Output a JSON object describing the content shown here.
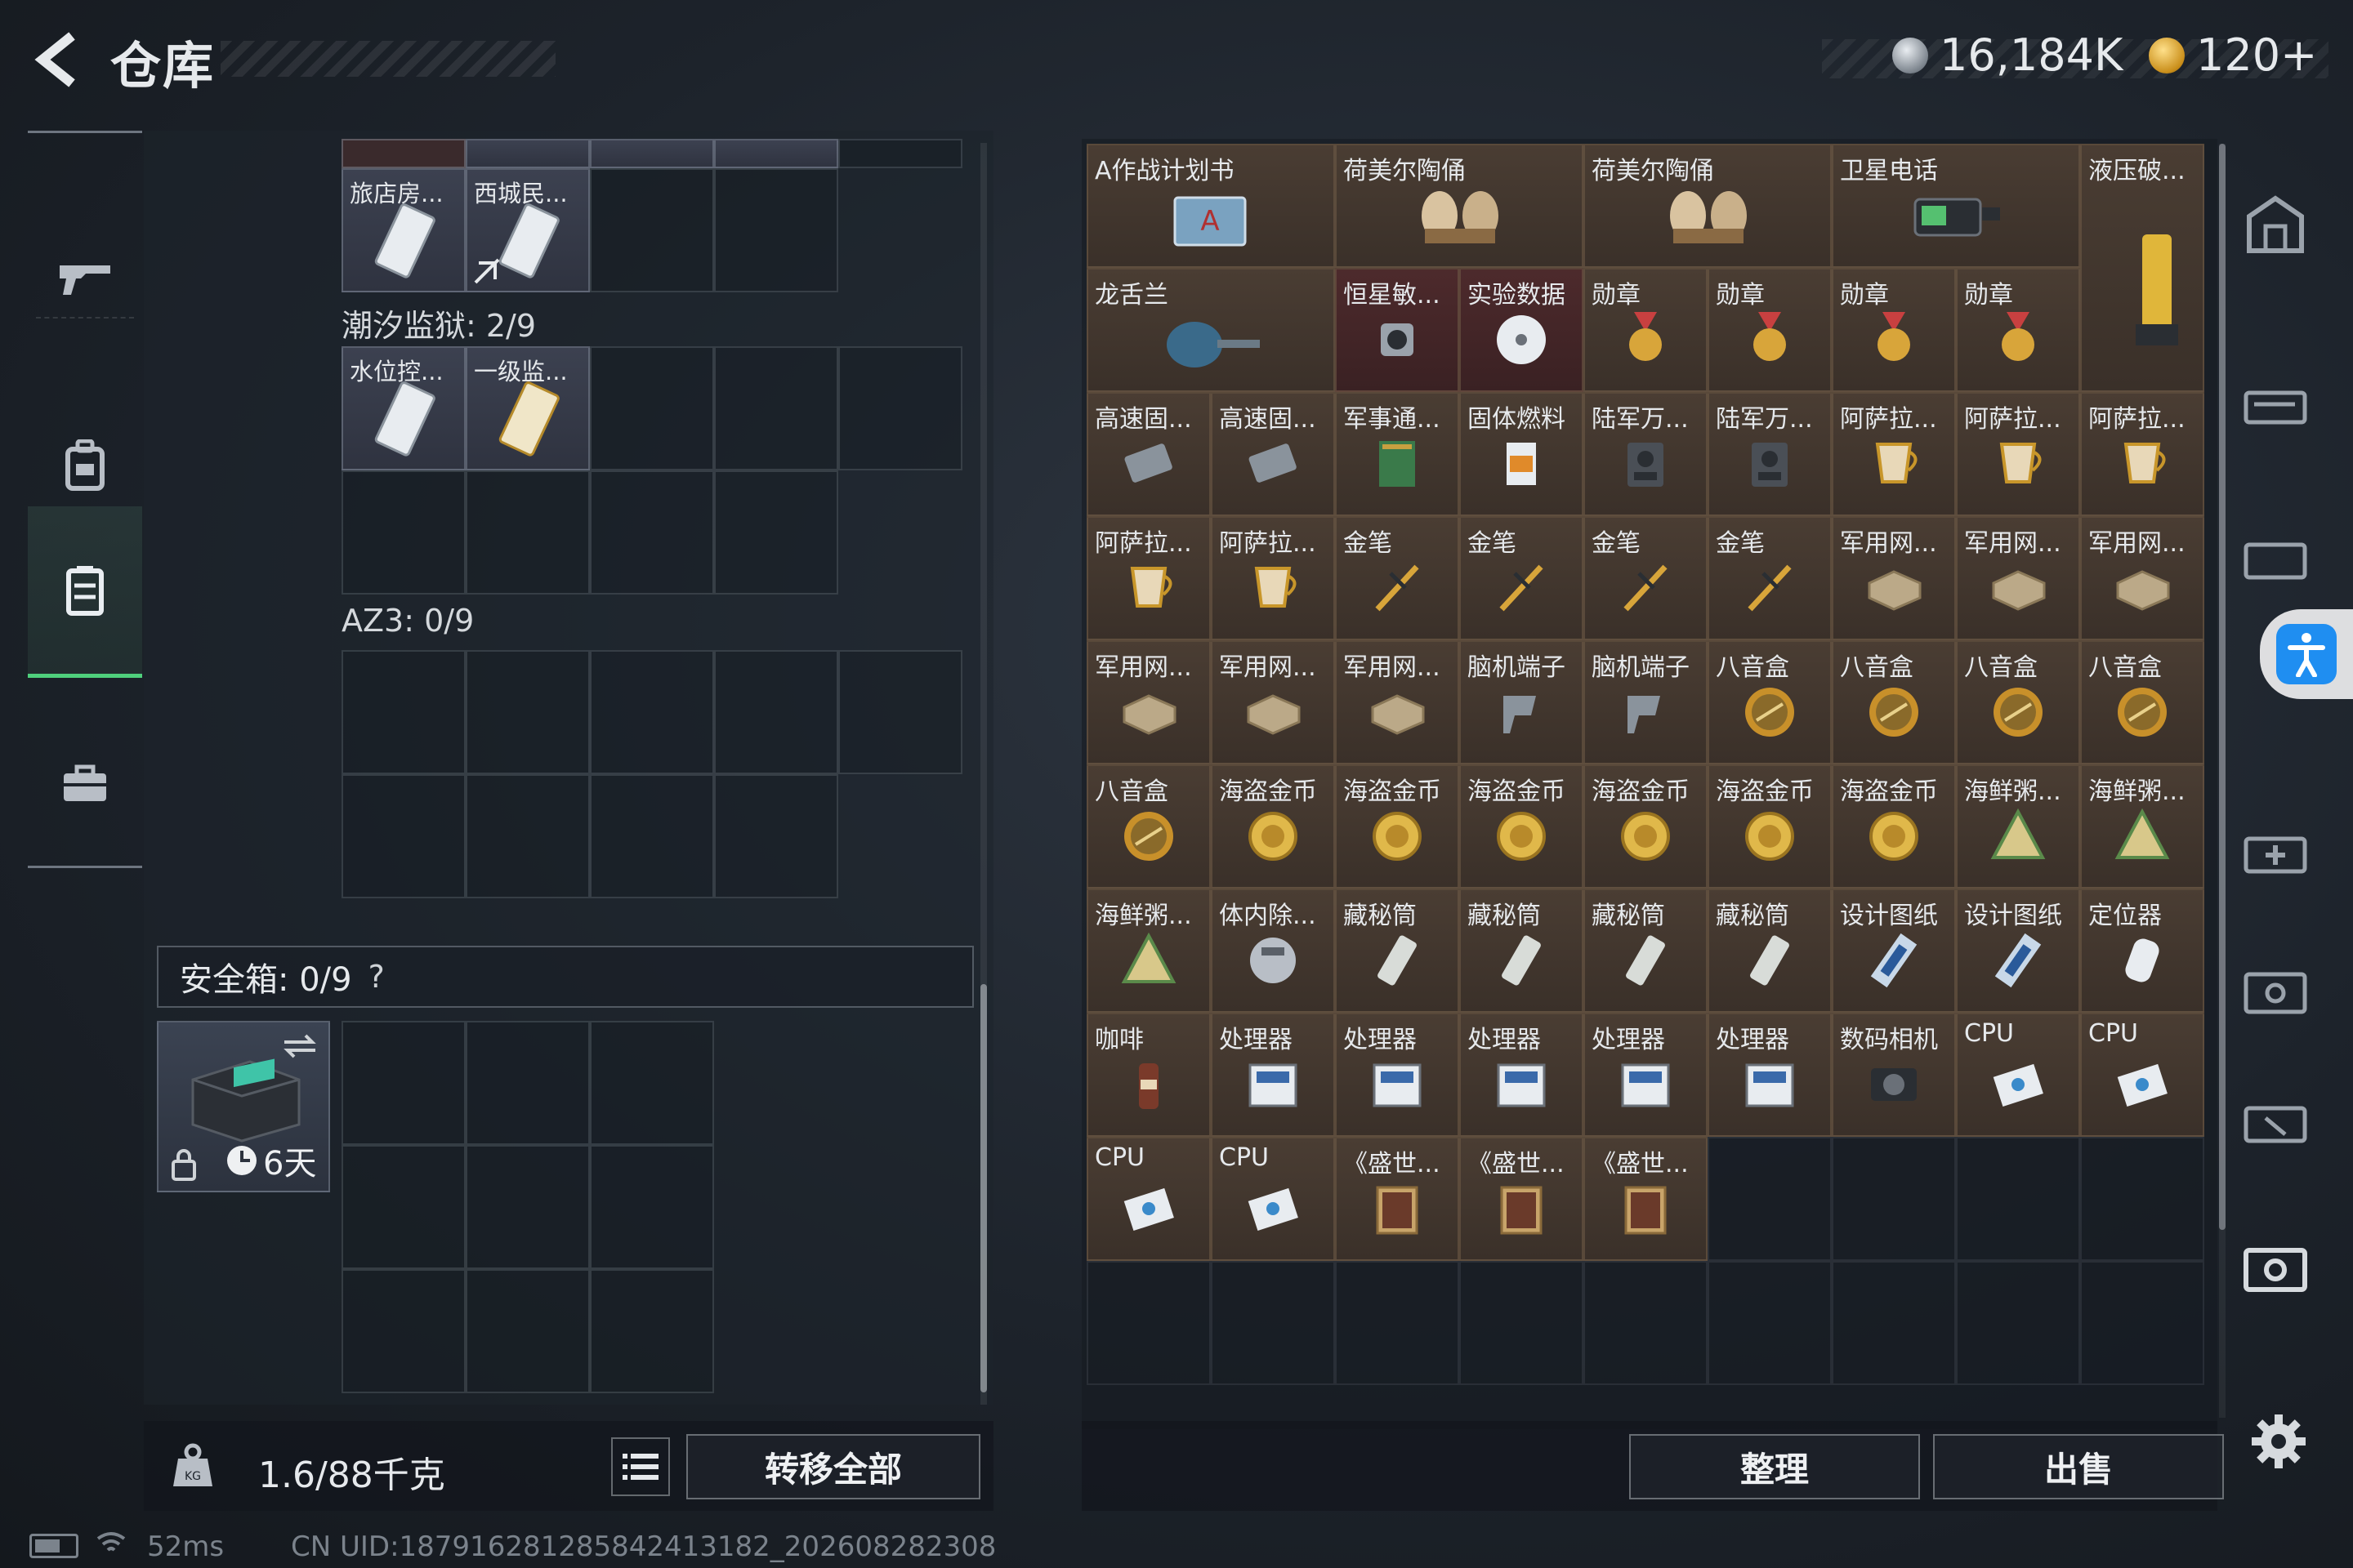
{
  "header": {
    "title": "仓库",
    "currency_silver": "16,184K",
    "currency_gold": "120+"
  },
  "nav": {
    "items": [
      {
        "icon": "gun-icon",
        "label": ""
      },
      {
        "icon": "backpack-icon",
        "label": ""
      },
      {
        "icon": "vest-icon",
        "label": "",
        "active": true
      },
      {
        "icon": "briefcase-icon",
        "label": ""
      }
    ]
  },
  "left": {
    "row0_labels": [
      "旅店房...",
      "西城民..."
    ],
    "tide_prison_label": "潮汐监狱: 2/9",
    "tide_items": [
      "水位控...",
      "一级监..."
    ],
    "az3_label": "AZ3: 0/9",
    "safebox_label": "安全箱: 0/9",
    "safebox_help": "?",
    "safebox_timer": "6天",
    "weight": "1.6/88千克",
    "transfer_all": "转移全部"
  },
  "stash": {
    "items": [
      {
        "label": "A作战计划书",
        "span": 2,
        "icon": "document-icon"
      },
      {
        "label": "荷美尔陶俑",
        "span": 2,
        "icon": "figurine-icon"
      },
      {
        "label": "荷美尔陶俑",
        "span": 2,
        "icon": "figurine-icon"
      },
      {
        "label": "卫星电话",
        "span": 2,
        "icon": "phone-icon"
      },
      {
        "label": "液压破...",
        "span": 1,
        "rowspan": 2,
        "icon": "hydraulic-icon"
      },
      {
        "label": "龙舌兰",
        "span": 2,
        "icon": "bottle-icon"
      },
      {
        "label": "恒星敏...",
        "icon": "sensor-icon",
        "red": true
      },
      {
        "label": "实验数据",
        "icon": "disc-icon",
        "red": true
      },
      {
        "label": "勋章",
        "icon": "medal-icon"
      },
      {
        "label": "勋章",
        "icon": "medal-icon"
      },
      {
        "label": "勋章",
        "icon": "medal-icon"
      },
      {
        "label": "勋章",
        "icon": "medal-icon"
      },
      {
        "label": "高速固...",
        "icon": "ssd-icon"
      },
      {
        "label": "高速固...",
        "icon": "ssd-icon"
      },
      {
        "label": "军事通...",
        "icon": "book-icon"
      },
      {
        "label": "固体燃料",
        "icon": "fuel-icon"
      },
      {
        "label": "陆军万...",
        "icon": "radio-icon"
      },
      {
        "label": "陆军万...",
        "icon": "radio-icon"
      },
      {
        "label": "阿萨拉...",
        "icon": "cup-icon"
      },
      {
        "label": "阿萨拉...",
        "icon": "cup-icon"
      },
      {
        "label": "阿萨拉...",
        "icon": "cup-icon"
      },
      {
        "label": "阿萨拉...",
        "icon": "cup-icon"
      },
      {
        "label": "阿萨拉...",
        "icon": "cup-icon"
      },
      {
        "label": "金笔",
        "icon": "pen-icon"
      },
      {
        "label": "金笔",
        "icon": "pen-icon"
      },
      {
        "label": "金笔",
        "icon": "pen-icon"
      },
      {
        "label": "金笔",
        "icon": "pen-icon"
      },
      {
        "label": "军用网...",
        "icon": "router-icon"
      },
      {
        "label": "军用网...",
        "icon": "router-icon"
      },
      {
        "label": "军用网...",
        "icon": "router-icon"
      },
      {
        "label": "军用网...",
        "icon": "router-icon"
      },
      {
        "label": "军用网...",
        "icon": "router-icon"
      },
      {
        "label": "军用网...",
        "icon": "router-icon"
      },
      {
        "label": "脑机端子",
        "icon": "neural-icon"
      },
      {
        "label": "脑机端子",
        "icon": "neural-icon"
      },
      {
        "label": "八音盒",
        "icon": "musicbox-icon"
      },
      {
        "label": "八音盒",
        "icon": "musicbox-icon"
      },
      {
        "label": "八音盒",
        "icon": "musicbox-icon"
      },
      {
        "label": "八音盒",
        "icon": "musicbox-icon"
      },
      {
        "label": "八音盒",
        "icon": "musicbox-icon"
      },
      {
        "label": "海盗金币",
        "icon": "coin-icon"
      },
      {
        "label": "海盗金币",
        "icon": "coin-icon"
      },
      {
        "label": "海盗金币",
        "icon": "coin-icon"
      },
      {
        "label": "海盗金币",
        "icon": "coin-icon"
      },
      {
        "label": "海盗金币",
        "icon": "coin-icon"
      },
      {
        "label": "海盗金币",
        "icon": "coin-icon"
      },
      {
        "label": "海鲜粥...",
        "icon": "rations-icon"
      },
      {
        "label": "海鲜粥...",
        "icon": "rations-icon"
      },
      {
        "label": "海鲜粥...",
        "icon": "rations-icon"
      },
      {
        "label": "体内除...",
        "icon": "device-icon"
      },
      {
        "label": "藏秘筒",
        "icon": "cylinder-icon"
      },
      {
        "label": "藏秘筒",
        "icon": "cylinder-icon"
      },
      {
        "label": "藏秘筒",
        "icon": "cylinder-icon"
      },
      {
        "label": "藏秘筒",
        "icon": "cylinder-icon"
      },
      {
        "label": "设计图纸",
        "icon": "blueprint-icon"
      },
      {
        "label": "设计图纸",
        "icon": "blueprint-icon"
      },
      {
        "label": "定位器",
        "icon": "tracker-icon"
      },
      {
        "label": "咖啡",
        "icon": "coffee-icon"
      },
      {
        "label": "处理器",
        "icon": "processor-icon"
      },
      {
        "label": "处理器",
        "icon": "processor-icon"
      },
      {
        "label": "处理器",
        "icon": "processor-icon"
      },
      {
        "label": "处理器",
        "icon": "processor-icon"
      },
      {
        "label": "处理器",
        "icon": "processor-icon"
      },
      {
        "label": "数码相机",
        "icon": "camera-icon"
      },
      {
        "label": "CPU",
        "icon": "cpu-icon"
      },
      {
        "label": "CPU",
        "icon": "cpu-icon"
      },
      {
        "label": "CPU",
        "icon": "cpu-icon"
      },
      {
        "label": "CPU",
        "icon": "cpu-icon"
      },
      {
        "label": "《盛世...",
        "icon": "painting-icon"
      },
      {
        "label": "《盛世...",
        "icon": "painting-icon"
      },
      {
        "label": "《盛世...",
        "icon": "painting-icon"
      }
    ],
    "sort_label": "整理",
    "sell_label": "出售"
  },
  "status": {
    "ping": "52ms",
    "uid": "CN UID:18791628128584241318​2_202608282308"
  },
  "colors": {
    "accent_green": "#4fd07c",
    "item_brown": "#4a3d33",
    "item_red": "#4d2a2c"
  }
}
